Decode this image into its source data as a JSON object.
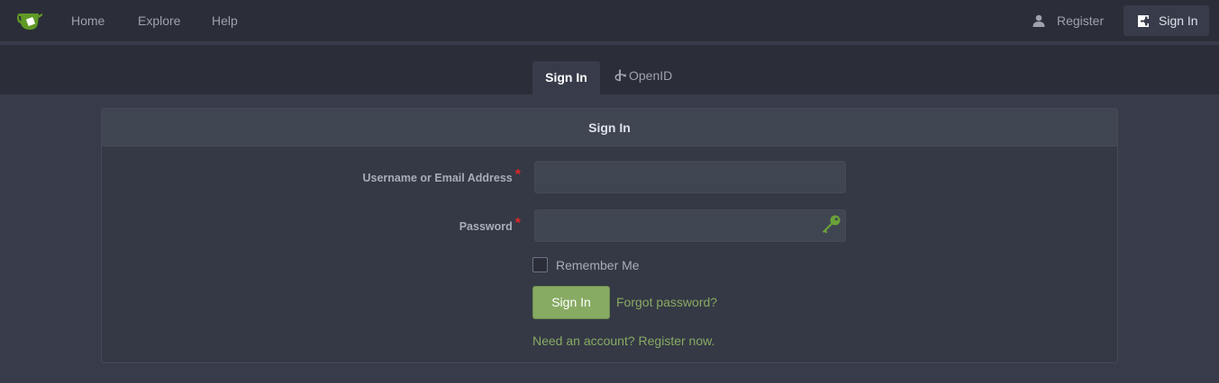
{
  "navbar": {
    "logo_icon": "gitea-teacup-logo",
    "home": "Home",
    "explore": "Explore",
    "help": "Help",
    "register": "Register",
    "register_icon": "person-icon",
    "sign_in": "Sign In",
    "sign_in_icon": "sign-in-icon"
  },
  "tabs": {
    "sign_in": "Sign In",
    "openid": "OpenID",
    "openid_icon": "openid-icon",
    "active": "sign_in"
  },
  "form": {
    "header": "Sign In",
    "username_label": "Username or Email Address",
    "username_value": "",
    "password_label": "Password",
    "password_value": "",
    "required_mark": "*",
    "password_icon": "key-icon",
    "remember_label": "Remember Me",
    "remember_checked": false,
    "submit_label": "Sign In",
    "forgot_link": "Forgot password?",
    "register_link": "Need an account? Register now."
  },
  "colors": {
    "accent": "#87ab63",
    "background": "#383c4a",
    "navbar": "#2b2e38",
    "required": "#db2828"
  }
}
